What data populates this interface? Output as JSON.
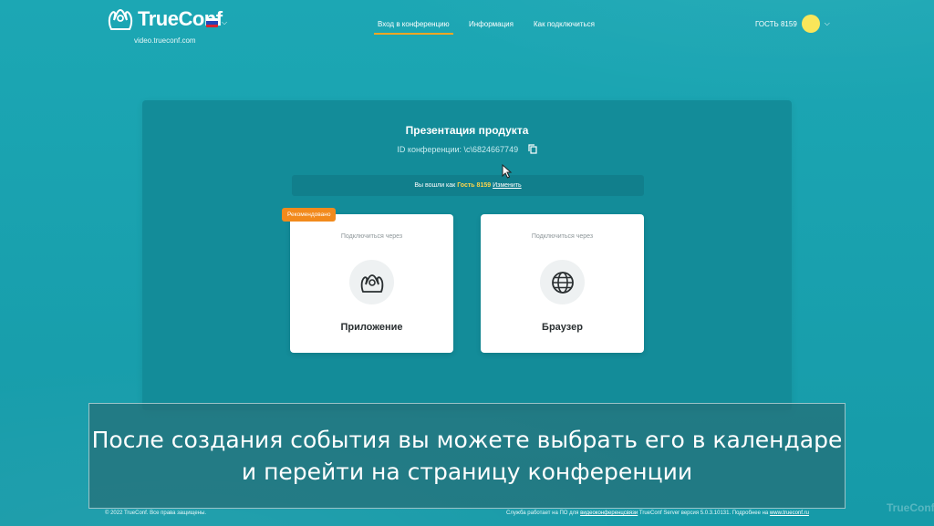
{
  "header": {
    "logo_text": "TrueConf",
    "logo_sub": "video.trueconf.com",
    "nav": [
      {
        "label": "Вход в конференцию"
      },
      {
        "label": "Информация"
      },
      {
        "label": "Как подключиться"
      }
    ],
    "user_name": "ГОСТЬ 8159"
  },
  "conference": {
    "title": "Презентация продукта",
    "id_line": "ID конференции: \\c\\6824667749",
    "login_prefix": "Вы вошли как",
    "login_guest": "Гость 8159",
    "login_change": "Изменить"
  },
  "cards": [
    {
      "badge": "Рекомендовано",
      "via": "Подключиться через",
      "label": "Приложение",
      "icon": "app-people-icon"
    },
    {
      "via": "Подключиться через",
      "label": "Браузер",
      "icon": "globe-icon"
    }
  ],
  "subtitle": {
    "line1": "После создания события вы можете выбрать его в календаре",
    "line2": "и перейти на страницу конференции"
  },
  "footer": {
    "copyright": "© 2022 TrueConf. Все права защищены.",
    "info_prefix": "Служба работает на ПО для",
    "info_link1": "видеоконференцсвязи",
    "info_middle": "TrueConf Server версия 5.0.3.10131. Подробнее на",
    "info_link2": "www.trueconf.ru"
  },
  "watermark": "TrueConf",
  "colors": {
    "background": "#1aa3b0",
    "accent": "#f5a623",
    "badge": "#f28a1c",
    "avatar": "#f9e65a"
  }
}
